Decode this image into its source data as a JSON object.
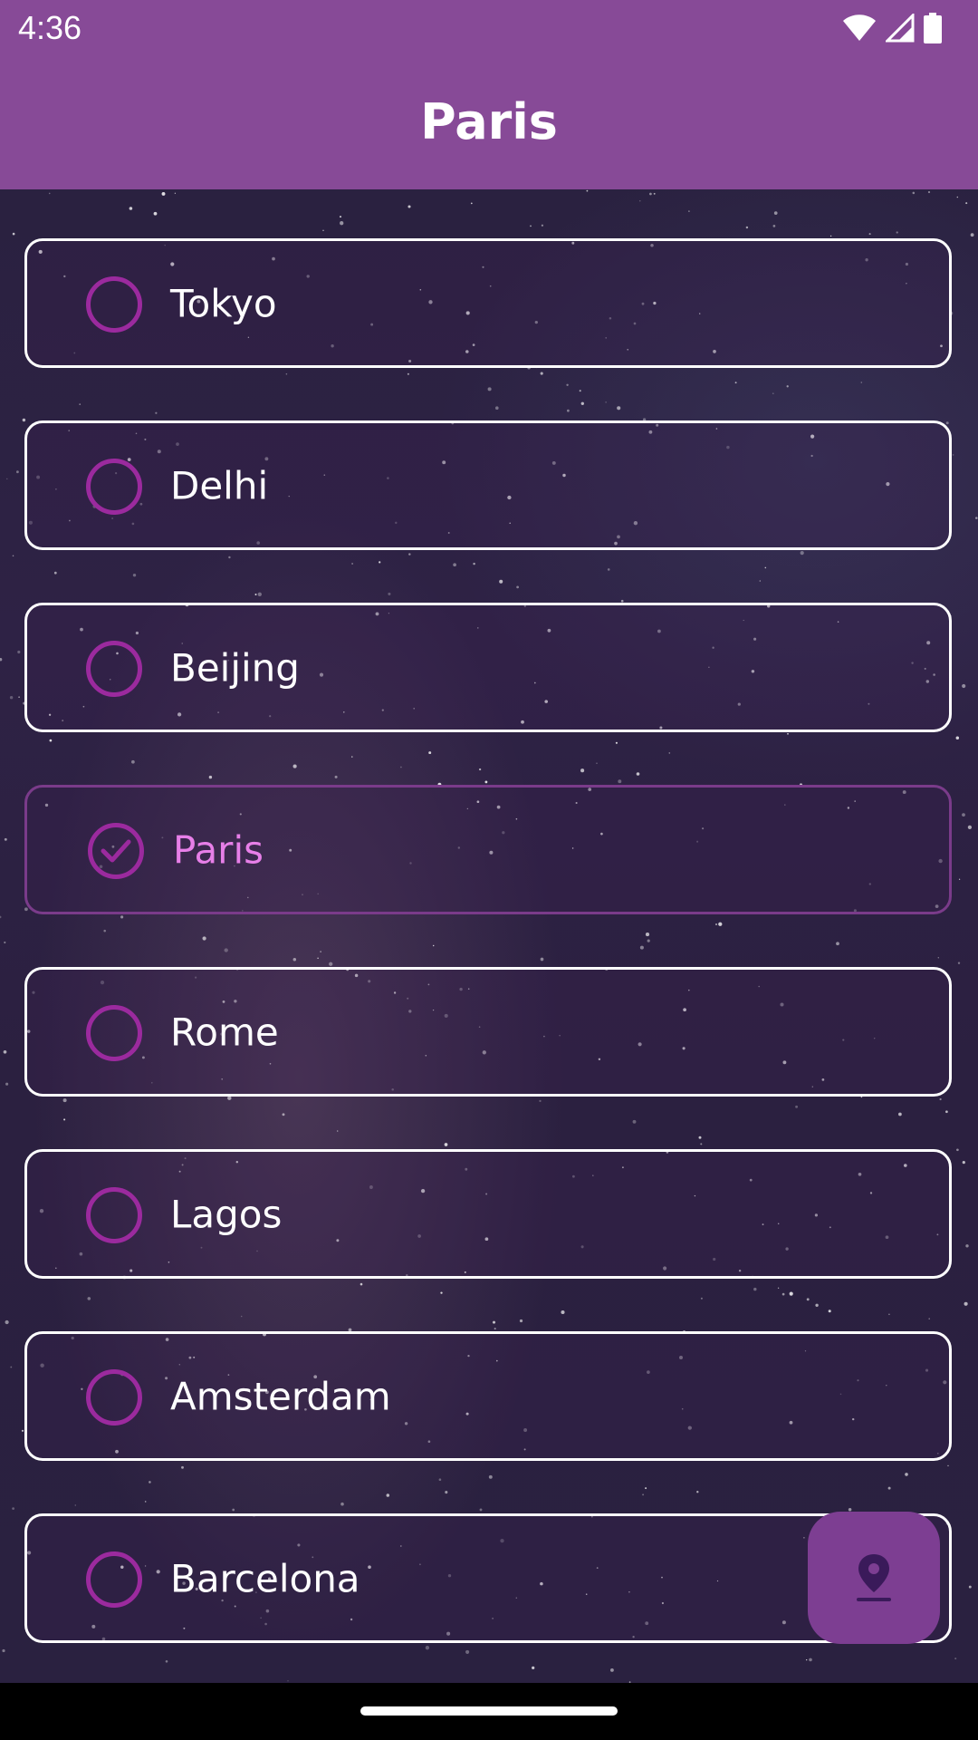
{
  "status_bar": {
    "time": "4:36",
    "icons": [
      "wifi-icon",
      "cellular-signal-icon",
      "battery-icon"
    ]
  },
  "app_bar": {
    "title": "Paris",
    "background_color": "#874a97"
  },
  "cities": [
    {
      "name": "Tokyo",
      "selected": false
    },
    {
      "name": "Delhi",
      "selected": false
    },
    {
      "name": "Beijing",
      "selected": false
    },
    {
      "name": "Paris",
      "selected": true
    },
    {
      "name": "Rome",
      "selected": false
    },
    {
      "name": "Lagos",
      "selected": false
    },
    {
      "name": "Amsterdam",
      "selected": false
    },
    {
      "name": "Barcelona",
      "selected": false
    }
  ],
  "fab": {
    "icon": "location-pin-icon",
    "background_color": "#7d3e92"
  },
  "colors": {
    "accent": "#9b2a9e",
    "selected_text": "#e77fe8",
    "card_border": "#ffffff"
  }
}
